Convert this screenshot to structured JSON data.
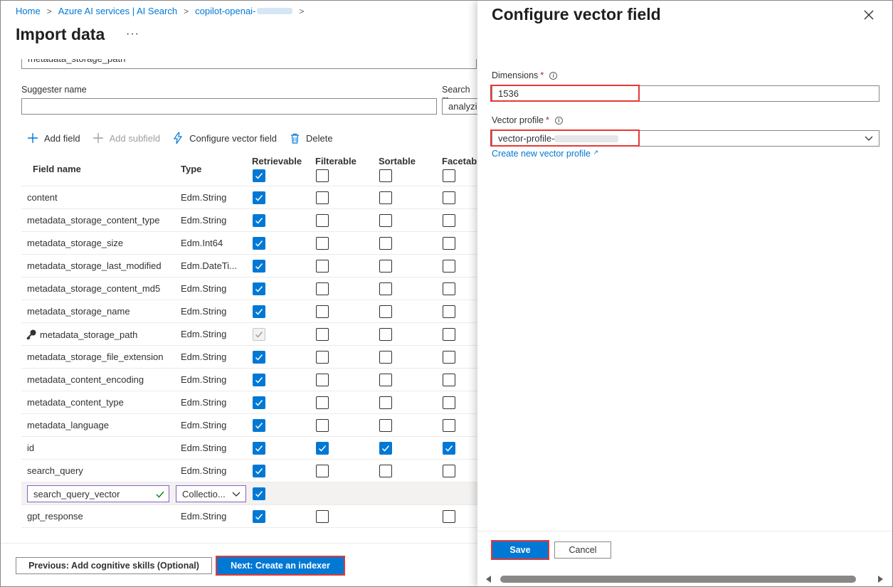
{
  "breadcrumb": {
    "items": [
      "Home",
      "Azure AI services | AI Search",
      "copilot-openai-"
    ]
  },
  "page": {
    "title": "Import data",
    "more": "···"
  },
  "form": {
    "cut_field_value": "metadata_storage_path",
    "suggester_label": "Suggester name",
    "suggester_value": "",
    "search_mode_label": "Search m",
    "search_mode_value": "analyzi"
  },
  "toolbar": {
    "add_field": "Add field",
    "add_subfield": "Add subfield",
    "configure_vector": "Configure vector field",
    "delete": "Delete"
  },
  "table": {
    "headers": {
      "field_name": "Field name",
      "type": "Type",
      "retrievable": "Retrievable",
      "filterable": "Filterable",
      "sortable": "Sortable",
      "facetable": "Facetab"
    },
    "rows": [
      {
        "name": "content",
        "type": "Edm.String",
        "retrievable": true,
        "filterable": false,
        "sortable": false,
        "facetable": false
      },
      {
        "name": "metadata_storage_content_type",
        "type": "Edm.String",
        "retrievable": true,
        "filterable": false,
        "sortable": false,
        "facetable": false
      },
      {
        "name": "metadata_storage_size",
        "type": "Edm.Int64",
        "retrievable": true,
        "filterable": false,
        "sortable": false,
        "facetable": false
      },
      {
        "name": "metadata_storage_last_modified",
        "type": "Edm.DateTi...",
        "retrievable": true,
        "filterable": false,
        "sortable": false,
        "facetable": false
      },
      {
        "name": "metadata_storage_content_md5",
        "type": "Edm.String",
        "retrievable": true,
        "filterable": false,
        "sortable": false,
        "facetable": false
      },
      {
        "name": "metadata_storage_name",
        "type": "Edm.String",
        "retrievable": true,
        "filterable": false,
        "sortable": false,
        "facetable": false
      },
      {
        "name": "metadata_storage_path",
        "type": "Edm.String",
        "retrievable": "disabled",
        "filterable": false,
        "sortable": false,
        "facetable": false,
        "key": true
      },
      {
        "name": "metadata_storage_file_extension",
        "type": "Edm.String",
        "retrievable": true,
        "filterable": false,
        "sortable": false,
        "facetable": false
      },
      {
        "name": "metadata_content_encoding",
        "type": "Edm.String",
        "retrievable": true,
        "filterable": false,
        "sortable": false,
        "facetable": false
      },
      {
        "name": "metadata_content_type",
        "type": "Edm.String",
        "retrievable": true,
        "filterable": false,
        "sortable": false,
        "facetable": false
      },
      {
        "name": "metadata_language",
        "type": "Edm.String",
        "retrievable": true,
        "filterable": false,
        "sortable": false,
        "facetable": false
      },
      {
        "name": "id",
        "type": "Edm.String",
        "retrievable": true,
        "filterable": true,
        "sortable": true,
        "facetable": true
      },
      {
        "name": "search_query",
        "type": "Edm.String",
        "retrievable": true,
        "filterable": false,
        "sortable": false,
        "facetable": false
      },
      {
        "name": "search_query_vector",
        "type": "Collectio...",
        "retrievable": true,
        "filterable": null,
        "sortable": null,
        "facetable": null,
        "editing": true
      },
      {
        "name": "gpt_response",
        "type": "Edm.String",
        "retrievable": true,
        "filterable": false,
        "sortable": null,
        "facetable": false
      }
    ]
  },
  "footer": {
    "previous": "Previous: Add cognitive skills (Optional)",
    "next": "Next: Create an indexer"
  },
  "panel": {
    "title": "Configure vector field",
    "dimensions_label": "Dimensions",
    "dimensions_value": "1536",
    "vector_profile_label": "Vector profile",
    "vector_profile_value": "vector-profile-",
    "create_profile_link": "Create new vector profile",
    "save": "Save",
    "cancel": "Cancel"
  },
  "colors": {
    "accent": "#0078d4",
    "highlight": "#e53935",
    "required": "#a4262c"
  }
}
